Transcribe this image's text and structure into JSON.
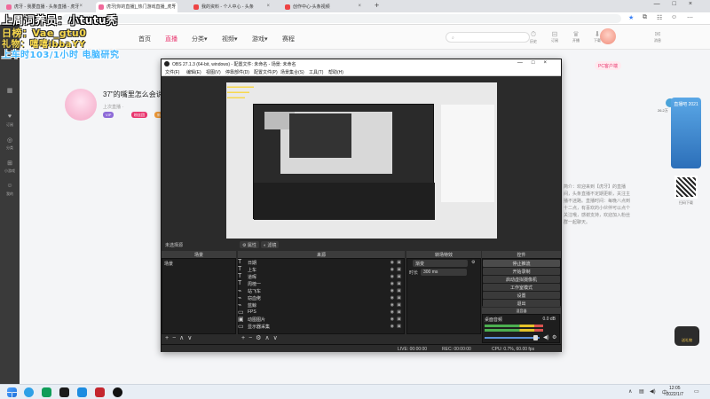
{
  "browser": {
    "tabs": [
      {
        "label": "虎牙 - 我要直播 - 头条直播 - 虎牙"
      },
      {
        "label": "虎牙[你的直播]_热门游戏直播_虎牙"
      },
      {
        "label": "我的资料 - 个人中心 - 头条"
      },
      {
        "label": "创作中心-头条视频"
      }
    ],
    "new_tab": "+",
    "url": "…om/2528141"
  },
  "overlay": {
    "line1": "上周词养员：小tutu秃",
    "line2": "日榜：Vae_gtu0",
    "line3": "礼物：嘻嘻ibbaYY",
    "line4": "上车时103/1小时  电脑研究"
  },
  "site": {
    "nav": [
      "首页",
      "直播",
      "分类▾",
      "视频▾",
      "游戏▾",
      "赛程"
    ],
    "active_nav": "直播",
    "left_rail": [
      {
        "icon": "▦",
        "label": "12"
      },
      {
        "icon": "♥",
        "label": "订阅"
      },
      {
        "icon": "◎",
        "label": "分类"
      },
      {
        "icon": "⊞",
        "label": "小游戏"
      },
      {
        "icon": "☺",
        "label": "我的"
      }
    ],
    "top_icons": [
      {
        "icon": "⏱",
        "label": "历史"
      },
      {
        "icon": "⊟",
        "label": "订阅"
      },
      {
        "icon": "♛",
        "label": "开播"
      },
      {
        "icon": "⬇",
        "label": "下载"
      },
      {
        "icon": "✉",
        "label": "消息"
      }
    ],
    "stream_title": "37\"的嘴里怎么会说出",
    "stream_meta": "上次直播 ·  ",
    "tags": [
      "VIP",
      "粉丝团",
      "新秀"
    ],
    "pc_button": "PC客户端",
    "fan_value": "26.2万",
    "description": "简介：欢迎来到【虎牙】的直播间，头条直播不定期更新，关注主播不迷路。直播时间：每晚八点到十二点，有喜欢的小伙伴可以点个关注哦，感谢支持，欢迎加入粉丝群一起聊天。",
    "banner": "直播吧\n2021",
    "qr_label": "扫码下载",
    "gift_label": "送礼物"
  },
  "obs": {
    "title": "OBS 27.1.3 (64-bit, windows) - 配置文件: 未命名 - 场景: 未命名",
    "menu": [
      "文件(F)",
      "编辑(E)",
      "视图(V)",
      "停靠部件(D)",
      "配置文件(P)",
      "场景集合(S)",
      "工具(T)",
      "帮助(H)"
    ],
    "no_source": "未选择源",
    "properties_btn": "属性",
    "filters_btn": "滤镜",
    "docks": {
      "scenes": "场景",
      "sources": "来源",
      "transitions": "转场特效",
      "controls": "控件",
      "mixer": "混音器"
    },
    "scene_items": [
      "场景"
    ],
    "sources": [
      {
        "icon": "T",
        "name": "日期"
      },
      {
        "icon": "T",
        "name": "上车"
      },
      {
        "icon": "T",
        "name": "道晖"
      },
      {
        "icon": "T",
        "name": "周榜一"
      },
      {
        "icon": "⌁",
        "name": "站飞车"
      },
      {
        "icon": "⌁",
        "name": "窃血佬"
      },
      {
        "icon": "⌁",
        "name": "蓝鲸"
      },
      {
        "icon": "▭",
        "name": "FPS"
      },
      {
        "icon": "▣",
        "name": "动图图片"
      },
      {
        "icon": "▭",
        "name": "显示器采集"
      }
    ],
    "transition": {
      "label": "渐变",
      "duration_label": "时长",
      "duration_value": "300 ms"
    },
    "controls": [
      {
        "label": "停止推流",
        "active": true
      },
      {
        "label": "开始录制",
        "active": false
      },
      {
        "label": "启动虚拟摄像机",
        "active": false
      },
      {
        "label": "工作室模式",
        "active": false
      },
      {
        "label": "设置",
        "active": false
      },
      {
        "label": "退出",
        "active": false
      }
    ],
    "mixer": {
      "name": "桌面音频",
      "db": "0.0 dB",
      "volume": 0.95
    },
    "status": {
      "live": "LIVE: 00:00:00",
      "rec": "REC: 00:00:00",
      "cpu": "CPU: 0.7%, 60.00 fps"
    }
  },
  "taskbar": {
    "time": "12:05",
    "date": "2022/1/7",
    "lang": "中"
  },
  "colors": {
    "accent": "#e9356e",
    "obs_bg": "#2b2b2b",
    "overlay_yellow": "#f7d84c",
    "overlay_blue": "#3fb6ff"
  }
}
